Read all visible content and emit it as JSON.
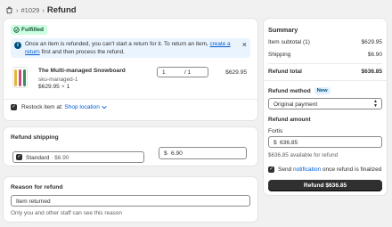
{
  "header": {
    "order_number": "#1029",
    "separator": "›",
    "title": "Refund"
  },
  "fulfillment": {
    "badge": "Fulfilled",
    "banner": {
      "text_before": "Once an item is refunded, you can't start a return for it. To return an item, ",
      "link": "create a return",
      "text_after": " first and then process the refund."
    },
    "product": {
      "name": "The Multi-managed Snowboard",
      "sku": "sku-managed-1",
      "unit_price": "$629.95",
      "times": "×",
      "quantity_label": "1",
      "quantity_value": "1",
      "max_quantity": "/ 1",
      "line_total": "$629.95"
    },
    "restock": {
      "label": "Restock item at:",
      "location": "Shop location"
    }
  },
  "refund_shipping": {
    "title": "Refund shipping",
    "option": "Standard",
    "option_amount": "· $6.90",
    "currency": "$",
    "amount": "6.90"
  },
  "reason": {
    "title": "Reason for refund",
    "value": "Item returned",
    "hint": "Only you and other staff can see this reason"
  },
  "summary": {
    "title": "Summary",
    "item_subtotal_label": "Item subtotal (1)",
    "item_subtotal_value": "$629.95",
    "shipping_label": "Shipping",
    "shipping_value": "$6.90",
    "refund_total_label": "Refund total",
    "refund_total_value": "$636.85",
    "method_label": "Refund method",
    "method_badge": "New",
    "method_value": "Original payment",
    "amount_label": "Refund amount",
    "gateway": "Fortis",
    "currency": "$",
    "amount": "636.85",
    "available": "$636.85 available for refund",
    "notify_before": "Send ",
    "notify_link": "notification",
    "notify_after": " once refund is finalized",
    "refund_button": "Refund $636.85"
  },
  "colors": {
    "primary_button": "#303030",
    "link": "#005bd3",
    "success_badge": "#cdfee1",
    "info_banner": "#eaf4ff"
  },
  "icons": {
    "order": "order-icon",
    "badge": "check-circle-icon",
    "banner": "info-icon",
    "dismiss": "close-icon",
    "select": "chevron-updown-icon",
    "location": "chevron-down-icon"
  }
}
